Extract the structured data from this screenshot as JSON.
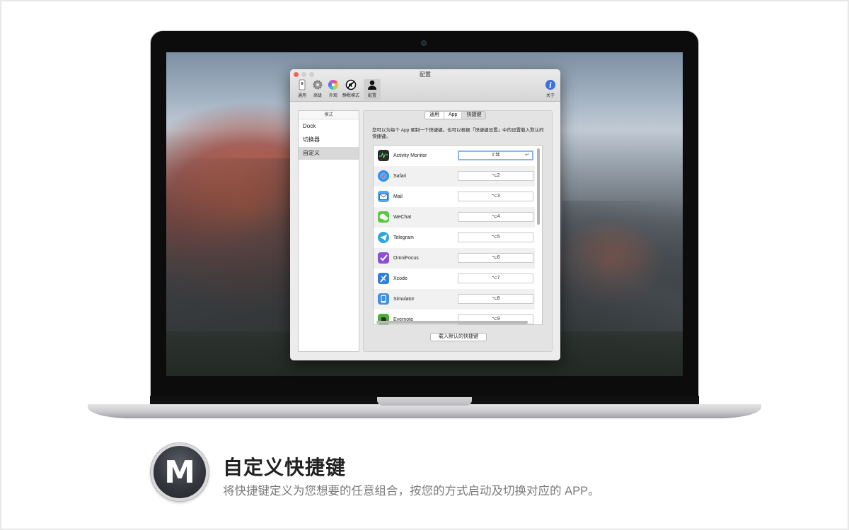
{
  "window": {
    "title": "配置",
    "toolbar": [
      {
        "label": "通用",
        "icon": "switch-icon"
      },
      {
        "label": "高级",
        "icon": "gear-icon"
      },
      {
        "label": "外观",
        "icon": "color-wheel-icon"
      },
      {
        "label": "静默模式",
        "icon": "no-sound-icon"
      },
      {
        "label": "配置",
        "icon": "user-silhouette-icon"
      }
    ],
    "about_label": "关于"
  },
  "sidebar": {
    "header": "模式",
    "items": [
      "Dock",
      "切换器",
      "自定义"
    ],
    "selected_index": 2
  },
  "tabs": [
    "通用",
    "App",
    "快捷键"
  ],
  "active_tab": "快捷键",
  "description": "您可以为每个 App 录制一个快捷键。也可以根据「快捷键设置」中的设置载入默认的快捷键。",
  "apps": [
    {
      "name": "Activity Monitor",
      "shortcut": "⇧⌘",
      "icon_color": "#2b2b2b"
    },
    {
      "name": "Safari",
      "shortcut": "⌥2",
      "icon_color": "#2a8ff0"
    },
    {
      "name": "Mail",
      "shortcut": "⌥3",
      "icon_color": "#5aa5e8"
    },
    {
      "name": "WeChat",
      "shortcut": "⌥4",
      "icon_color": "#5bc544"
    },
    {
      "name": "Telegram",
      "shortcut": "⌥5",
      "icon_color": "#2ea6e0"
    },
    {
      "name": "OmniFocus",
      "shortcut": "⌥6",
      "icon_color": "#8a4fd6"
    },
    {
      "name": "Xcode",
      "shortcut": "⌥7",
      "icon_color": "#2d7fe0"
    },
    {
      "name": "Simulator",
      "shortcut": "⌥8",
      "icon_color": "#3f8fe6"
    },
    {
      "name": "Evernote",
      "shortcut": "⌥9",
      "icon_color": "#4cae3a"
    }
  ],
  "return_glyph": "↵",
  "load_defaults_label": "载入默认的快捷键",
  "caption": {
    "logo_letter": "M",
    "title": "自定义快捷键",
    "subtitle": "将快捷键定义为您想要的任意组合，按您的方式启动及切换对应的 APP。"
  }
}
